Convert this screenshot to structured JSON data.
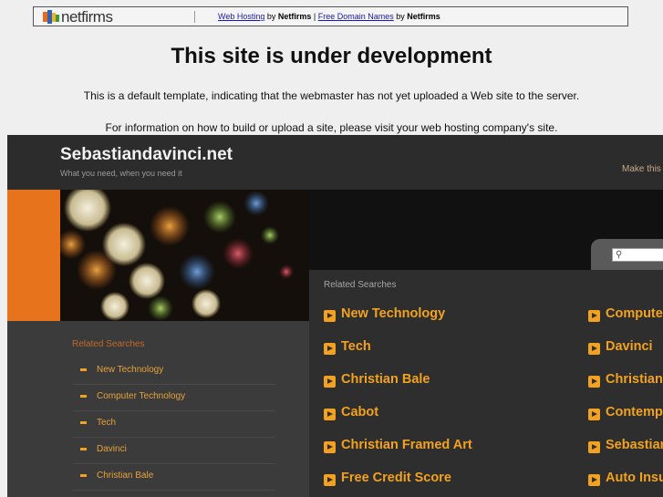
{
  "netfirms_bar": {
    "logo": "netfirms",
    "link1": "Web Hosting",
    "by1": " by ",
    "brand1": "Netfirms",
    "pipe": " | ",
    "link2": "Free Domain Names",
    "by2": " by ",
    "brand2": "Netfirms"
  },
  "notice": {
    "title": "This site is under development",
    "line1": "This is a default template, indicating that the webmaster has not yet uploaded a Web site to the server.",
    "line2": "For information on how to build or upload a site, please visit your web hosting company's site."
  },
  "site": {
    "name": "Sebastiandavinci.net",
    "tagline": "What you need, when you need it",
    "make_this": "Make this"
  },
  "related_searches": {
    "title": "Related Searches",
    "col1": [
      "New Technology",
      "Tech",
      "Christian Bale",
      "Cabot",
      "Christian Framed Art",
      "Free Credit Score"
    ],
    "col2": [
      "Compute",
      "Davinci",
      "Christian",
      "Contemp",
      "Sebastian",
      "Auto Insu"
    ]
  },
  "left_related": {
    "title": "Related Searches",
    "items": [
      "New Technology",
      "Computer Technology",
      "Tech",
      "Davinci",
      "Christian Bale"
    ]
  },
  "colors": {
    "accent_orange": "#f2a21e",
    "banner_orange": "#e7731d",
    "panel_dark": "#2e2e2e"
  }
}
